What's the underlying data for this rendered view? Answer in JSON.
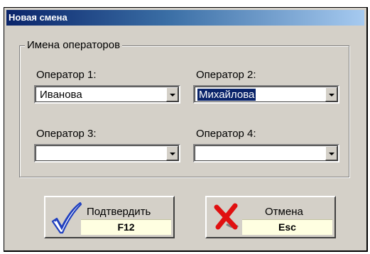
{
  "window": {
    "title": "Новая смена"
  },
  "group": {
    "legend": "Имена операторов"
  },
  "operators": [
    {
      "label": "Оператор 1:",
      "value": "Иванова",
      "selected": false
    },
    {
      "label": "Оператор 2:",
      "value": "Михайлова",
      "selected": true
    },
    {
      "label": "Оператор 3:",
      "value": "",
      "selected": false
    },
    {
      "label": "Оператор 4:",
      "value": "",
      "selected": false
    }
  ],
  "buttons": {
    "confirm": {
      "label": "Подтвердить",
      "key": "F12",
      "icon": "checkmark-icon"
    },
    "cancel": {
      "label": "Отмена",
      "key": "Esc",
      "icon": "cross-icon"
    }
  },
  "colors": {
    "titlebar_start": "#0a246a",
    "titlebar_end": "#a6caf0",
    "face": "#d4d0c8",
    "key_strip": "#ffffe1",
    "check_blue": "#1f3fbf",
    "cross_red": "#e01010"
  }
}
